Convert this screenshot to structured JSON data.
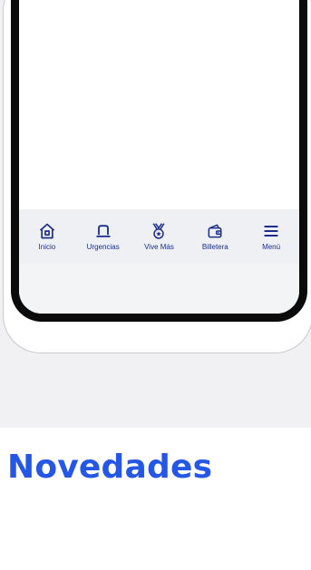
{
  "nav": {
    "items": [
      {
        "label": "Inicio",
        "icon": "home-icon"
      },
      {
        "label": "Urgencias",
        "icon": "siren-icon"
      },
      {
        "label": "Vive Más",
        "icon": "medal-icon"
      },
      {
        "label": "Billetera",
        "icon": "wallet-icon"
      },
      {
        "label": "Menú",
        "icon": "menu-icon"
      }
    ]
  },
  "section": {
    "title": "Novedades"
  },
  "colors": {
    "accent": "#2457e5",
    "nav_text": "#1b2e8c",
    "nav_bg": "#eef0f4",
    "page_bg": "#f1f1f3"
  }
}
